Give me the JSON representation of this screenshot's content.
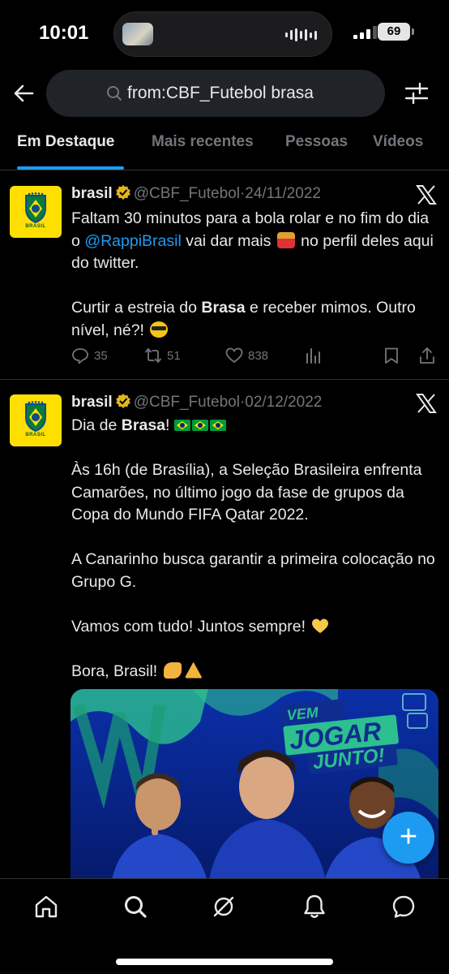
{
  "status_bar": {
    "time": "10:01",
    "battery": "69"
  },
  "search": {
    "query": "from:CBF_Futebol brasa"
  },
  "tabs": [
    {
      "label": "Em Destaque",
      "active": true
    },
    {
      "label": "Mais recentes",
      "active": false
    },
    {
      "label": "Pessoas",
      "active": false
    },
    {
      "label": "Vídeos",
      "active": false
    }
  ],
  "tweets": [
    {
      "avatar_text": "BRASIL",
      "name": "brasil",
      "handle": "@CBF_Futebol",
      "date": "24/11/2022",
      "text": {
        "line1": "Faltam 30 minutos para a bola rolar e no fim do dia o",
        "mention": "@RappiBrasil",
        "line2": " vai dar mais ",
        "line3": " no perfil deles aqui do twitter.",
        "p2_pre": "Curtir a estreia do ",
        "p2_bold": "Brasa",
        "p2_post": " e receber mimos. Outro nível, né?! "
      },
      "stats": {
        "replies": "35",
        "retweets": "51",
        "likes": "838"
      }
    },
    {
      "avatar_text": "BRASIL",
      "name": "brasil",
      "handle": "@CBF_Futebol",
      "date": "02/12/2022",
      "text": {
        "p1_pre": "Dia de ",
        "p1_bold": "Brasa",
        "p1_post": "! ",
        "p2": "Às 16h (de Brasília), a Seleção Brasileira enfrenta Camarões, no último jogo da fase de grupos da Copa do Mundo FIFA Qatar 2022.",
        "p3": "A Canarinho busca garantir a primeira colocação no Grupo G.",
        "p4": "Vamos com tudo! Juntos sempre! ",
        "p5": "Bora, Brasil! "
      },
      "media": {
        "line1": "VEM",
        "line2": "JOGAR",
        "line3": "JUNTO!"
      }
    }
  ],
  "fab": {
    "label": "+"
  },
  "colors": {
    "accent": "#1d9bf0",
    "background": "#000000",
    "muted": "#71767b",
    "brasil_yellow": "#fedf00",
    "brasil_green": "#009b3a"
  },
  "icons": {
    "back": "arrow-left-icon",
    "search": "search-icon",
    "filter": "sliders-icon",
    "verified": "verified-gold-badge-icon",
    "x": "x-logo-icon",
    "reply": "reply-icon",
    "retweet": "retweet-icon",
    "like": "heart-icon",
    "views": "bar-chart-icon",
    "bookmark": "bookmark-icon",
    "share": "share-icon",
    "nav_home": "home-icon",
    "nav_search": "search-icon",
    "nav_grok": "grok-icon",
    "nav_notifications": "bell-icon",
    "nav_messages": "message-icon"
  }
}
